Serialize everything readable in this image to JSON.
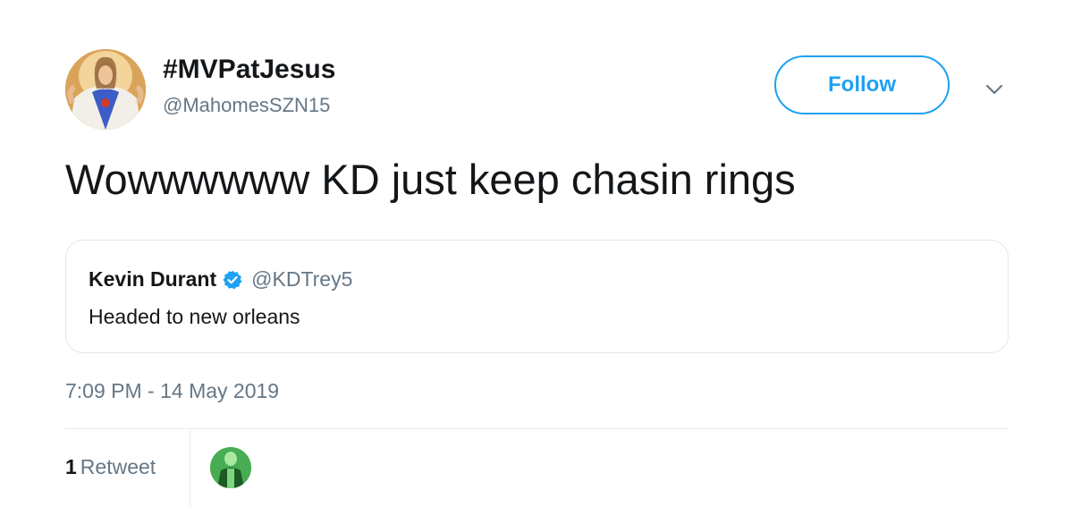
{
  "tweet": {
    "author": {
      "display_name": "#MVPatJesus",
      "handle": "@MahomesSZN15"
    },
    "follow_label": "Follow",
    "text": "Wowwwwww KD just keep chasin rings",
    "quoted": {
      "display_name": "Kevin Durant",
      "handle": "@KDTrey5",
      "text": "Headed to new orleans",
      "verified": true
    },
    "timestamp": "7:09 PM - 14 May 2019",
    "stats": {
      "retweet_count": "1",
      "retweet_label": "Retweet"
    }
  },
  "icons": {
    "verified": "verified-badge-icon",
    "caret": "chevron-down-icon"
  },
  "colors": {
    "accent": "#1da1f2",
    "secondary_text": "#657786",
    "primary_text": "#14171a",
    "border": "#e1e8ed"
  }
}
